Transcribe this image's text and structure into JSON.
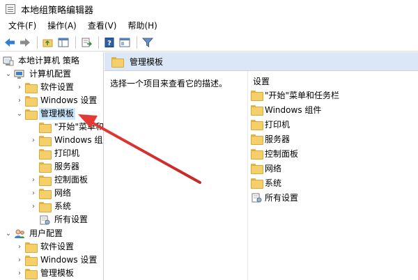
{
  "window": {
    "title": "本地组策略编辑器"
  },
  "menu": {
    "items": [
      "文件(F)",
      "操作(A)",
      "查看(V)",
      "帮助(H)"
    ]
  },
  "toolbar": {
    "icons": [
      "back-arrow-icon",
      "forward-arrow-icon",
      "folder-up-icon",
      "show-tree-icon",
      "export-icon",
      "help-icon",
      "properties-icon",
      "filter-icon"
    ]
  },
  "tree": {
    "root": "本地计算机 策略",
    "computer_config": "计算机配置",
    "computer_children": [
      "软件设置",
      "Windows 设置",
      "管理模板"
    ],
    "admin_templates_children": [
      "\"开始\"菜单和",
      "Windows 组件",
      "打印机",
      "服务器",
      "控制面板",
      "网络",
      "系统",
      "所有设置"
    ],
    "user_config": "用户配置",
    "user_children": [
      "软件设置",
      "Windows 设置",
      "管理模板"
    ]
  },
  "right": {
    "header_title": "管理模板",
    "description": "选择一个项目来查看它的描述。",
    "column_header": "设置",
    "items": [
      "\"开始\"菜单和任务栏",
      "Windows 组件",
      "打印机",
      "服务器",
      "控制面板",
      "网络",
      "系统",
      "所有设置"
    ]
  },
  "colors": {
    "selection": "#cce8ff",
    "header_bg": "#dbe7f6",
    "folder": "#f5cf6a",
    "arrow": "#e53935"
  }
}
